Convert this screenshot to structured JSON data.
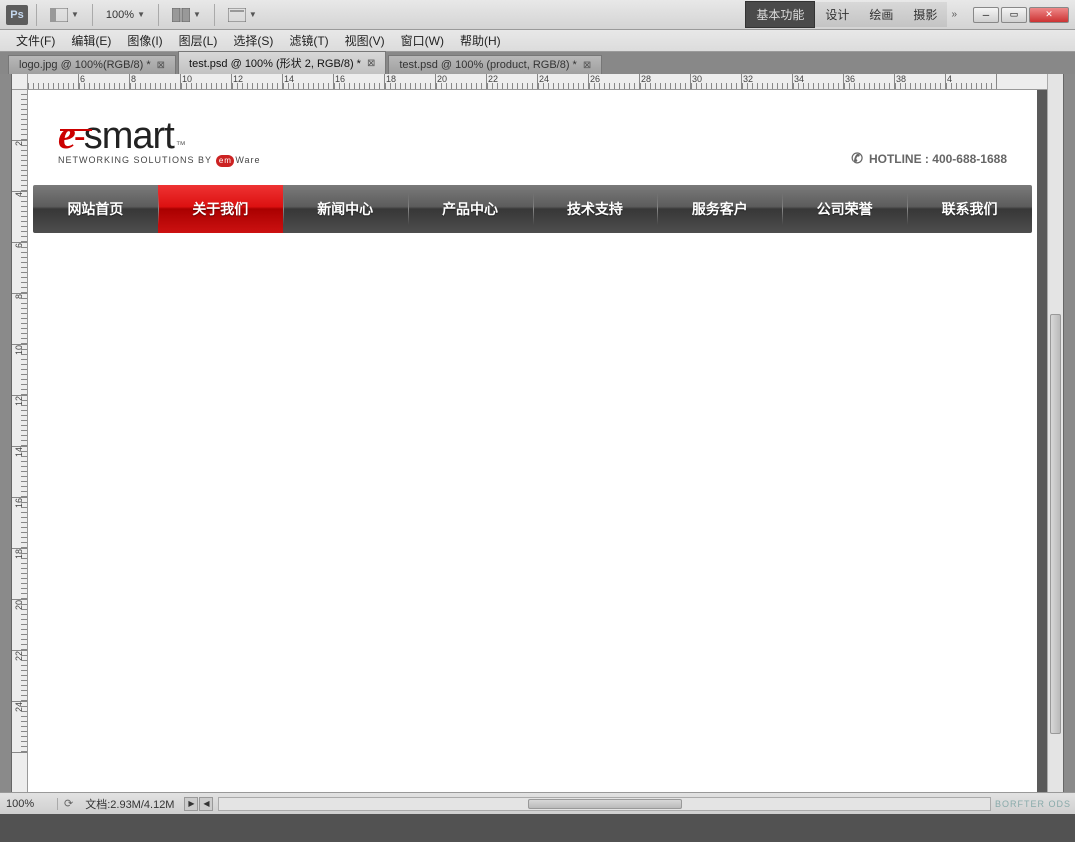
{
  "topbar": {
    "logo": "Ps",
    "zoom": "100%",
    "workspaces": [
      "基本功能",
      "设计",
      "绘画",
      "摄影"
    ],
    "active_workspace": 0
  },
  "menubar": [
    "文件(F)",
    "编辑(E)",
    "图像(I)",
    "图层(L)",
    "选择(S)",
    "滤镜(T)",
    "视图(V)",
    "窗口(W)",
    "帮助(H)"
  ],
  "doctabs": [
    {
      "label": "logo.jpg @ 100%(RGB/8) *"
    },
    {
      "label": "test.psd @ 100% (形状 2, RGB/8) *"
    },
    {
      "label": "test.psd @ 100% (product, RGB/8) *"
    }
  ],
  "active_doctab": 1,
  "ruler_h": [
    "",
    "6",
    "8",
    "10",
    "12",
    "14",
    "16",
    "18",
    "20",
    "22",
    "24",
    "26",
    "28",
    "30",
    "32",
    "34",
    "36",
    "38",
    "4"
  ],
  "ruler_v": [
    "",
    "2",
    "4",
    "6",
    "8",
    "10",
    "12",
    "14",
    "16",
    "18",
    "20",
    "22",
    "24"
  ],
  "design": {
    "logo": {
      "e": "e",
      "smart": "smart",
      "tm": "™",
      "sub_pre": "NETWORKING SOLUTIONS BY",
      "sub_em": "em",
      "sub_post": "Ware"
    },
    "hotline": "HOTLINE : 400-688-1688",
    "nav": [
      "网站首页",
      "关于我们",
      "新闻中心",
      "产品中心",
      "技术支持",
      "服务客户",
      "公司荣誉",
      "联系我们"
    ],
    "nav_active": 1
  },
  "statusbar": {
    "zoom": "100%",
    "doc": "文档:2.93M/4.12M",
    "watermark": "BORFTER ODS"
  }
}
